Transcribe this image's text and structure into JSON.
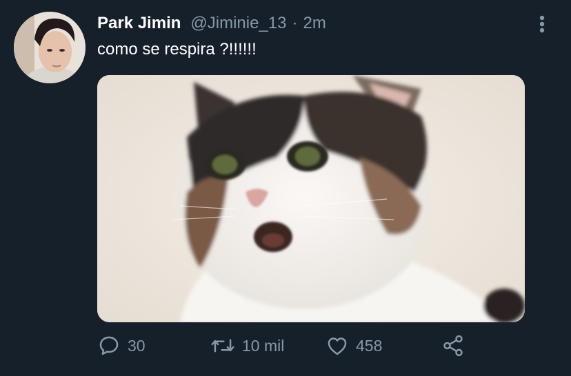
{
  "tweet": {
    "author": {
      "display_name": "Park Jimin",
      "handle": "@Jiminie_13",
      "separator": "·",
      "time": "2m"
    },
    "text": "como se respira ?!!!!!!",
    "actions": {
      "reply": {
        "icon": "reply-icon",
        "count": "30"
      },
      "retweet": {
        "icon": "retweet-icon",
        "count": "10 mil"
      },
      "like": {
        "icon": "heart-icon",
        "count": "458"
      },
      "share": {
        "icon": "share-icon"
      }
    },
    "more_icon": "more-vertical-icon"
  },
  "colors": {
    "background": "#15202b",
    "primary_text": "#ffffff",
    "secondary_text": "#8899a6"
  }
}
